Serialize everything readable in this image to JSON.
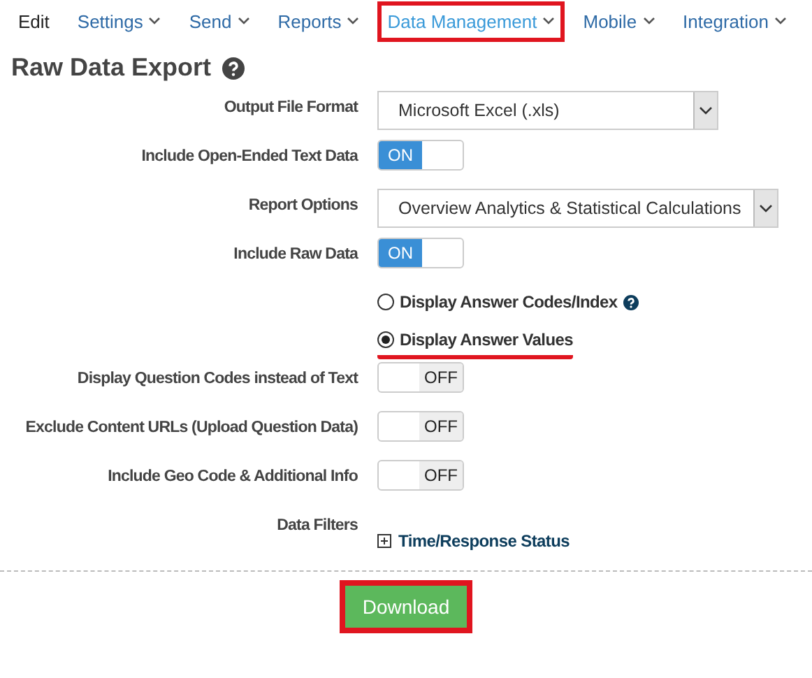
{
  "menu": [
    {
      "label": "Edit",
      "has_caret": false,
      "highlighted": false
    },
    {
      "label": "Settings",
      "has_caret": true,
      "highlighted": false
    },
    {
      "label": "Send",
      "has_caret": true,
      "highlighted": false
    },
    {
      "label": "Reports",
      "has_caret": true,
      "highlighted": false
    },
    {
      "label": "Data Management",
      "has_caret": true,
      "highlighted": true
    },
    {
      "label": "Mobile",
      "has_caret": true,
      "highlighted": false
    },
    {
      "label": "Integration",
      "has_caret": true,
      "highlighted": false
    }
  ],
  "page_title": "Raw Data Export",
  "fields": [
    {
      "kind": "select",
      "label": "Output File Format",
      "value": "Microsoft Excel (.xls)"
    },
    {
      "kind": "toggle",
      "label": "Include Open-Ended Text Data",
      "on": true,
      "text": "ON"
    },
    {
      "kind": "select",
      "label": "Report Options",
      "value": "Overview Analytics & Statistical Calculations"
    },
    {
      "kind": "toggle",
      "label": "Include Raw Data",
      "on": true,
      "text": "ON"
    },
    {
      "kind": "radio",
      "label": "Display Answer Codes/Index",
      "selected": false,
      "help": true,
      "underlined": false
    },
    {
      "kind": "radio",
      "label": "Display Answer Values",
      "selected": true,
      "help": false,
      "underlined": true
    },
    {
      "kind": "toggle",
      "label": "Display Question Codes instead of Text",
      "on": false,
      "text": "OFF"
    },
    {
      "kind": "toggle",
      "label": "Exclude Content URLs (Upload Question Data)",
      "on": false,
      "text": "OFF"
    },
    {
      "kind": "toggle",
      "label": "Include Geo Code & Additional Info",
      "on": false,
      "text": "OFF"
    },
    {
      "kind": "filter",
      "label": "Data Filters",
      "link": "Time/Response Status",
      "expanded": false
    }
  ],
  "download": {
    "label": "Download",
    "highlighted": true
  }
}
